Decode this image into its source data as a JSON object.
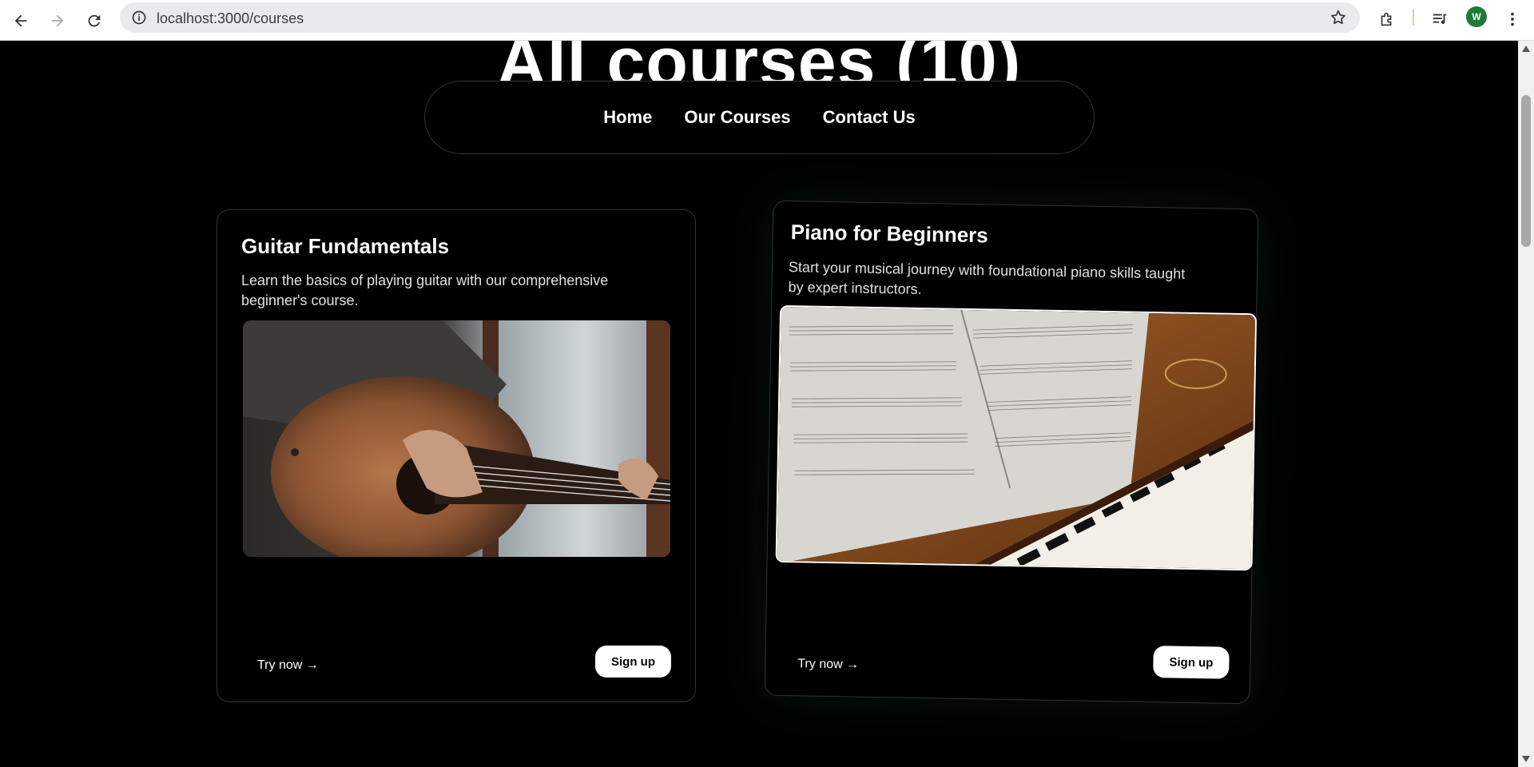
{
  "browser": {
    "url": "localhost:3000/courses",
    "profile_initial": "W",
    "colors": {
      "avatar": "#1e7b34"
    }
  },
  "page": {
    "title": "All courses (10)",
    "nav": [
      "Home",
      "Our Courses",
      "Contact Us"
    ]
  },
  "courses": [
    {
      "title": "Guitar Fundamentals",
      "description": "Learn the basics of playing guitar with our comprehensive beginner's course.",
      "image": "acoustic-guitar-photo",
      "try_label": "Try now →",
      "signup_label": "Sign up"
    },
    {
      "title": "Piano for Beginners",
      "description": "Start your musical journey with foundational piano skills taught by expert instructors.",
      "image": "piano-sheet-music-photo",
      "try_label": "Try now →",
      "signup_label": "Sign up"
    }
  ]
}
